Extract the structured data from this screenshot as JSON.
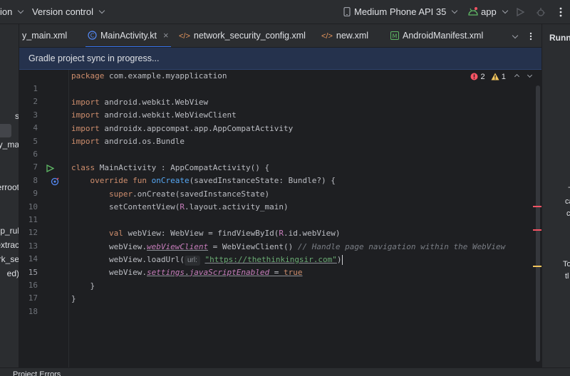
{
  "titlebar": {
    "menu_partial": "ion",
    "version_control": "Version control",
    "device": "Medium Phone API 35",
    "run_config": "app"
  },
  "left_panel": {
    "items": [
      "s",
      "y_ma",
      "erroot",
      "p_rul",
      "extrac",
      "ork_se",
      "ed)"
    ]
  },
  "tabs": [
    {
      "label": "y_main.xml",
      "active": false
    },
    {
      "label": "MainActivity.kt",
      "active": true
    },
    {
      "label": "network_security_config.xml",
      "active": false
    },
    {
      "label": "new.xml",
      "active": false
    },
    {
      "label": "AndroidManifest.xml",
      "active": false
    }
  ],
  "banner": {
    "text": "Gradle project sync in progress..."
  },
  "inspection": {
    "errors": "2",
    "warnings": "1"
  },
  "editor": {
    "current_line": 15,
    "line_numbers": [
      "1",
      "2",
      "3",
      "4",
      "5",
      "6",
      "7",
      "8",
      "9",
      "10",
      "11",
      "12",
      "13",
      "14",
      "15",
      "16",
      "17",
      "18"
    ],
    "code": {
      "l1_kw": "package",
      "l1_rest": " com.example.myapplication",
      "l3_kw": "import",
      "l3_rest": " android.webkit.WebView",
      "l4_kw": "import",
      "l4_rest": " android.webkit.WebViewClient",
      "l5_kw": "import",
      "l5_rest": " androidx.appcompat.app.AppCompatActivity",
      "l6_kw": "import",
      "l6_rest": " android.os.Bundle",
      "l8_kw": "class",
      "l8_name": " MainActivity",
      "l8_rest": " : AppCompatActivity() {",
      "l9_kw": "    override fun ",
      "l9_fn": "onCreate",
      "l9_rest": "(savedInstanceState: Bundle?) {",
      "l10_kw": "        super",
      "l10_rest": ".onCreate(savedInstanceState)",
      "l11_a": "        setContentView(",
      "l11_r": "R",
      "l11_b": ".layout.activity_main)",
      "l13_kw": "        val",
      "l13_a": " webView: WebView = findViewById(",
      "l13_r": "R",
      "l13_b": ".id.webView)",
      "l14_a": "        webView.",
      "l14_prop": "webViewClient",
      "l14_b": " = WebViewClient() ",
      "l14_cm": "// Handle page navigation within the WebView",
      "l15_a": "        webView.loadUrl(",
      "l15_hint": "url:",
      "l15_str": "\"https://thethinkingsir.com\"",
      "l15_b": ")",
      "l16_a": "        webView.",
      "l16_p1": "settings",
      "l16_dot": ".",
      "l16_p2": "javaScriptEnabled",
      "l16_eq": " = ",
      "l16_kw": "true",
      "l17": "    }",
      "l18": "}"
    }
  },
  "right_panel": {
    "title": "Runni",
    "frag1": "-",
    "frag2": "ca",
    "frag3": "c",
    "frag4": "To",
    "frag5": "tl"
  },
  "status": {
    "label": "Project Errors"
  },
  "colors": {
    "accent": "#3574f0",
    "error": "#f75464",
    "warning": "#f2c55c"
  }
}
